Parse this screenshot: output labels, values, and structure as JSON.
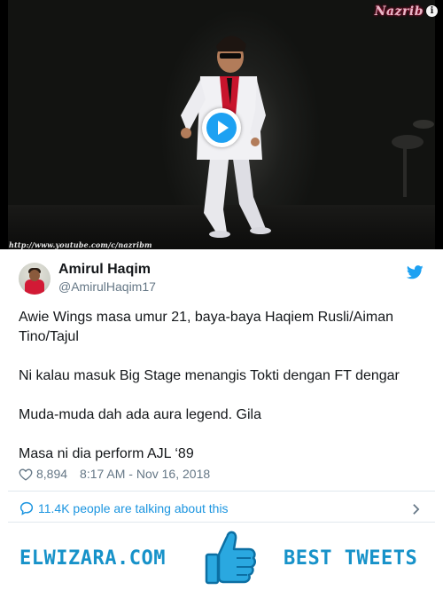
{
  "video": {
    "watermark": "Nazrib",
    "info_badge": "i",
    "url_caption": "http://www.youtube.com/c/nazribm",
    "play_icon": "play-icon"
  },
  "tweet": {
    "display_name": "Amirul Haqim",
    "handle": "@AmirulHaqim17",
    "lines": [
      "Awie Wings masa umur 21, baya-baya Haqiem Rusli/Aiman Tino/Tajul",
      "Ni kalau masuk Big Stage menangis Tokti dengan FT dengar",
      "Muda-muda dah ada aura legend. Gila",
      "Masa ni dia perform AJL ‘89"
    ],
    "likes": "8,894",
    "timestamp": "8:17 AM - Nov 16, 2018",
    "talking": "11.4K people are talking about this"
  },
  "banner": {
    "brand": "ELWIZARA.COM",
    "tagline": "BEST TWEETS"
  },
  "colors": {
    "twitter_blue": "#1da1f2",
    "link_blue": "#1b95e0",
    "banner_blue": "#1792c9",
    "muted": "#657786",
    "text": "#14171a"
  }
}
